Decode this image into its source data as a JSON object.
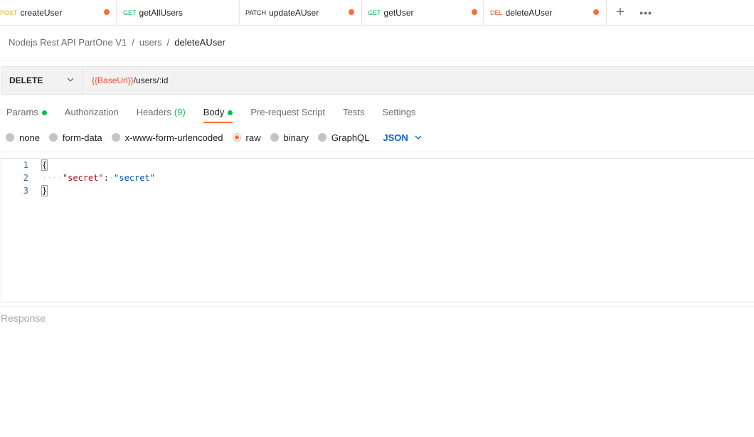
{
  "tabs": [
    {
      "method": "POST",
      "method_color": "#f5a623",
      "name": "createUser",
      "unsaved": true,
      "active": false
    },
    {
      "method": "GET",
      "method_color": "#0cbb52",
      "name": "getAllUsers",
      "unsaved": false,
      "active": false
    },
    {
      "method": "PATCH",
      "method_color": "#212121",
      "name": "updateAUser",
      "unsaved": true,
      "active": false
    },
    {
      "method": "GET",
      "method_color": "#0cbb52",
      "name": "getUser",
      "unsaved": true,
      "active": false
    },
    {
      "method": "DEL",
      "method_color": "#e0572a",
      "name": "deleteAUser",
      "unsaved": true,
      "active": true
    }
  ],
  "tab_actions": {
    "add_icon": "plus-icon",
    "more_icon": "more-horizontal-icon"
  },
  "breadcrumb": {
    "collection": "Nodejs Rest API PartOne V1",
    "folder": "users",
    "separator": "/",
    "current": "deleteAUser"
  },
  "request": {
    "method": "DELETE",
    "url_variable": "{{BaseUrl}}",
    "url_path": "/users/:id"
  },
  "request_tabs": {
    "params": "Params",
    "authorization": "Authorization",
    "headers": "Headers",
    "headers_count": "(9)",
    "body": "Body",
    "pre_request": "Pre-request Script",
    "tests": "Tests",
    "settings": "Settings"
  },
  "body_types": {
    "none": "none",
    "form_data": "form-data",
    "urlencoded": "x-www-form-urlencoded",
    "raw": "raw",
    "binary": "binary",
    "graphql": "GraphQL",
    "language": "JSON",
    "selected": "raw"
  },
  "editor": {
    "line_numbers": [
      "1",
      "2",
      "3"
    ],
    "open_brace": "{",
    "indent": "····",
    "key": "\"secret\"",
    "colon": ":",
    "space": "·",
    "value": "\"secret\"",
    "close_brace": "}"
  },
  "response": {
    "label": "Response"
  },
  "colors": {
    "accent": "#ff6c37",
    "ok": "#0cbb52",
    "link": "#0265d2"
  }
}
